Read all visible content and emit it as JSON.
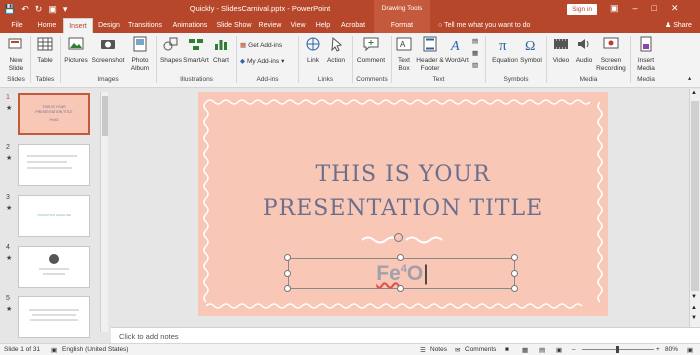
{
  "window": {
    "title": "Quickly - SlidesCarnival.pptx  -  PowerPoint",
    "contextual_header": "Drawing Tools",
    "sign_in": "Sign in",
    "accent": "#b7472a"
  },
  "qat": {
    "save_icon": "save-icon",
    "undo_icon": "undo-icon",
    "redo_icon": "redo-icon",
    "present_icon": "start-presentation-icon"
  },
  "tabs": [
    "File",
    "Home",
    "Insert",
    "Design",
    "Transitions",
    "Animations",
    "Slide Show",
    "Review",
    "View",
    "Help",
    "Acrobat",
    "Format"
  ],
  "active_tab": "Insert",
  "tell_me": "Tell me what you want to do",
  "share": "Share",
  "ribbon": {
    "new_slide": "New Slide",
    "table": "Table",
    "pictures": "Pictures",
    "screenshot": "Screenshot",
    "photo_album": "Photo Album",
    "shapes": "Shapes",
    "smartart": "SmartArt",
    "chart": "Chart",
    "get_addins": "Get Add-ins",
    "my_addins": "My Add-ins",
    "link": "Link",
    "action": "Action",
    "comment": "Comment",
    "text_box": "Text Box",
    "header_footer": "Header & Footer",
    "wordart": "WordArt",
    "equation": "Equation",
    "symbol": "Symbol",
    "video": "Video",
    "audio": "Audio",
    "screen_recording": "Screen Recording",
    "insert_media": "Insert Media",
    "groups": {
      "slides": "Slides",
      "tables": "Tables",
      "images": "Images",
      "illustrations": "Illustrations",
      "addins": "Add-ins",
      "links": "Links",
      "comments": "Comments",
      "text": "Text",
      "symbols": "Symbols",
      "media": "Media",
      "media2": "Media"
    }
  },
  "thumbnails": [
    {
      "num": "1",
      "title": "THIS IS YOUR PRESENTATION TITLE",
      "sub": "Fe4O"
    },
    {
      "num": "2",
      "title": "",
      "sub": ""
    },
    {
      "num": "3",
      "title": "TRANSITION HEADLINE",
      "sub": ""
    },
    {
      "num": "4",
      "title": "",
      "sub": ""
    },
    {
      "num": "5",
      "title": "",
      "sub": ""
    }
  ],
  "slide": {
    "title_line1": "THIS IS YOUR",
    "title_line2": "PRESENTATION TITLE",
    "subtitle_base": "Fe",
    "subtitle_sup": "4",
    "subtitle_end": "O",
    "bg": "#f8c7b6",
    "title_color": "#6b6f8c"
  },
  "notes_placeholder": "Click to add notes",
  "status": {
    "slide_of": "Slide 1 of 31",
    "language": "English (United States)",
    "notes": "Notes",
    "comments": "Comments",
    "zoom": "80%"
  }
}
